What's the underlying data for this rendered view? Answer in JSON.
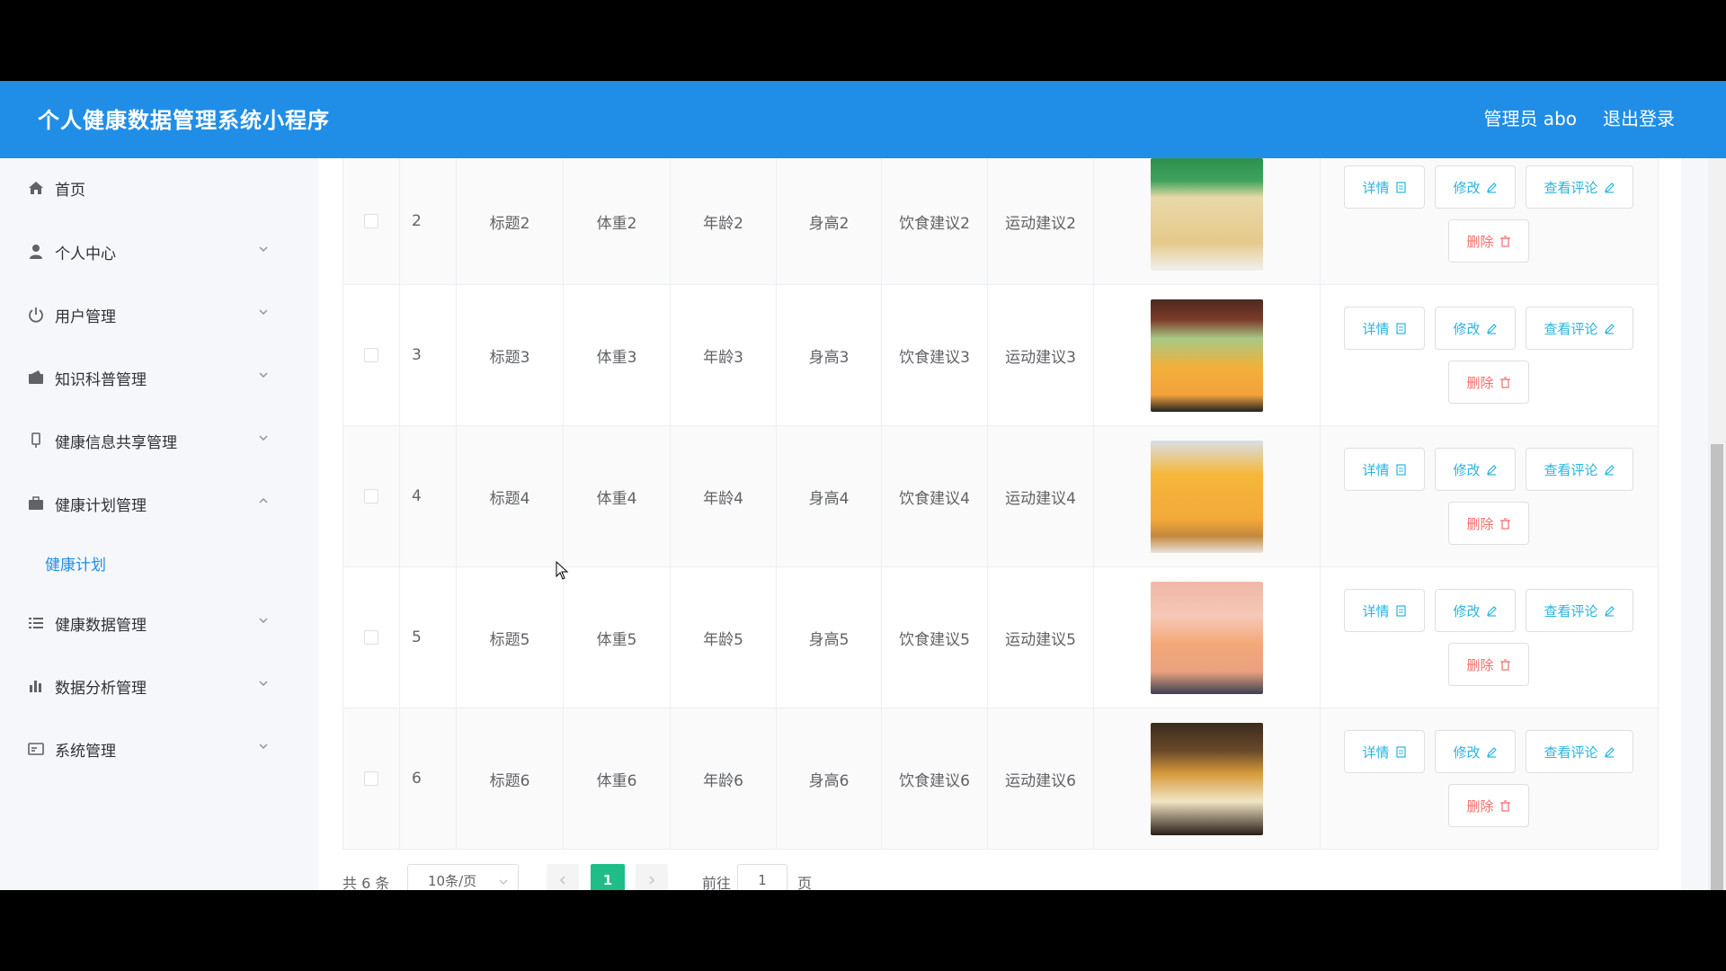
{
  "header": {
    "title": "个人健康数据管理系统小程序",
    "user": "管理员 abo",
    "logout": "退出登录"
  },
  "sidebar": {
    "items": [
      {
        "label": "首页",
        "icon": "home-icon"
      },
      {
        "label": "个人中心",
        "icon": "user-icon"
      },
      {
        "label": "用户管理",
        "icon": "power-icon"
      },
      {
        "label": "知识科普管理",
        "icon": "wallet-icon"
      },
      {
        "label": "健康信息共享管理",
        "icon": "device-icon"
      },
      {
        "label": "健康计划管理",
        "icon": "briefcase-icon"
      },
      {
        "label": "健康数据管理",
        "icon": "list-icon"
      },
      {
        "label": "数据分析管理",
        "icon": "bar-chart-icon"
      },
      {
        "label": "系统管理",
        "icon": "card-icon"
      }
    ],
    "active_submenu": "健康计划"
  },
  "table": {
    "rows": [
      {
        "index": "2",
        "title": "标题2",
        "weight": "体重2",
        "age": "年龄2",
        "height": "身高2",
        "diet": "饮食建议2",
        "exercise": "运动建议2"
      },
      {
        "index": "3",
        "title": "标题3",
        "weight": "体重3",
        "age": "年龄3",
        "height": "身高3",
        "diet": "饮食建议3",
        "exercise": "运动建议3"
      },
      {
        "index": "4",
        "title": "标题4",
        "weight": "体重4",
        "age": "年龄4",
        "height": "身高4",
        "diet": "饮食建议4",
        "exercise": "运动建议4"
      },
      {
        "index": "5",
        "title": "标题5",
        "weight": "体重5",
        "age": "年龄5",
        "height": "身高5",
        "diet": "饮食建议5",
        "exercise": "运动建议5"
      },
      {
        "index": "6",
        "title": "标题6",
        "weight": "体重6",
        "age": "年龄6",
        "height": "身高6",
        "diet": "饮食建议6",
        "exercise": "运动建议6"
      }
    ],
    "actions": {
      "detail": "详情",
      "edit": "修改",
      "comments": "查看评论",
      "delete": "删除"
    }
  },
  "pagination": {
    "total": "共 6 条",
    "page_size": "10条/页",
    "current": "1",
    "goto": "前往",
    "goto_value": "1",
    "unit": "页"
  },
  "colors": {
    "header": "#208ee6",
    "active": "#208ee6",
    "page_active": "#1fbe89",
    "info": "#29b3e0",
    "danger": "#f56c6c"
  }
}
